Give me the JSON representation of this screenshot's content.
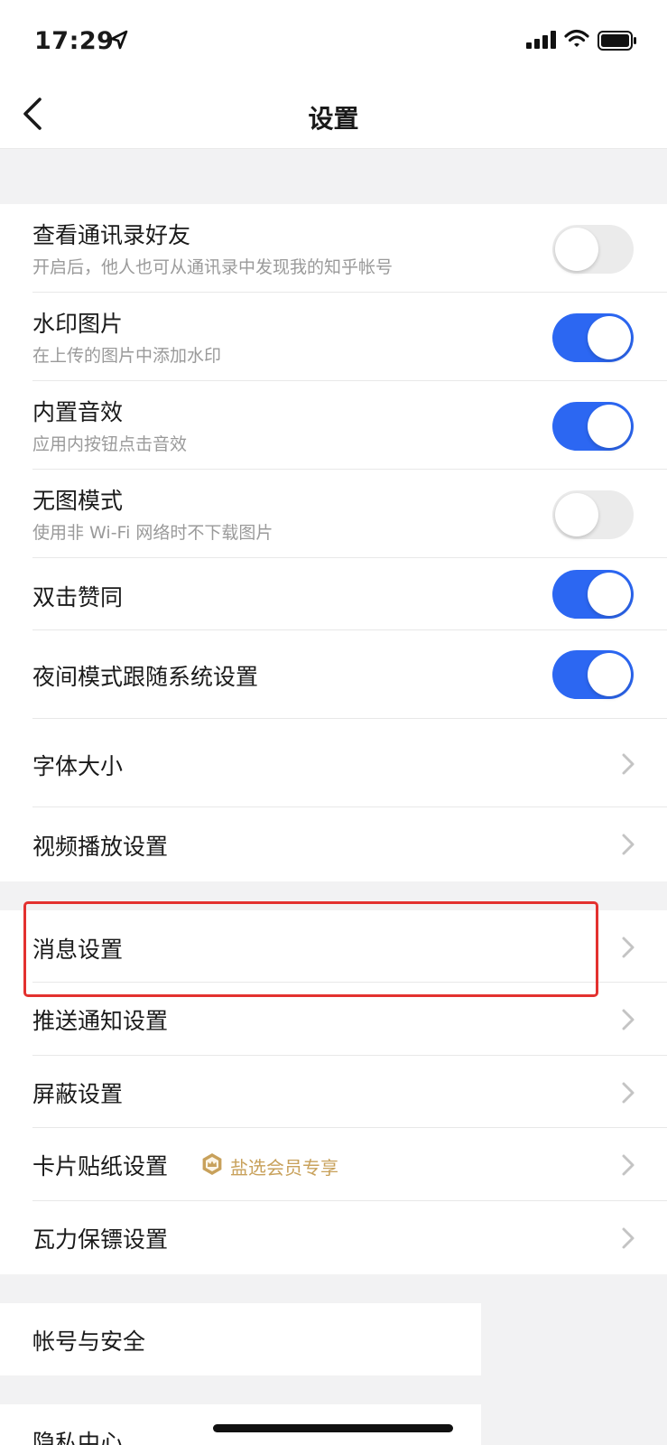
{
  "status_bar": {
    "time": "17:29"
  },
  "nav": {
    "title": "设置"
  },
  "group1": [
    {
      "title": "查看通讯录好友",
      "subtitle": "开启后，他人也可从通讯录中发现我的知乎帐号",
      "toggle": "off"
    },
    {
      "title": "水印图片",
      "subtitle": "在上传的图片中添加水印",
      "toggle": "on"
    },
    {
      "title": "内置音效",
      "subtitle": "应用内按钮点击音效",
      "toggle": "on"
    },
    {
      "title": "无图模式",
      "subtitle": "使用非 Wi-Fi 网络时不下载图片",
      "toggle": "off"
    },
    {
      "title": "双击赞同",
      "toggle": "on"
    },
    {
      "title": "夜间模式跟随系统设置",
      "toggle": "on"
    },
    {
      "title": "字体大小"
    },
    {
      "title": "视频播放设置"
    }
  ],
  "group2": [
    {
      "title": "消息设置"
    },
    {
      "title": "推送通知设置"
    },
    {
      "title": "屏蔽设置"
    },
    {
      "title": "卡片贴纸设置",
      "badge": "盐选会员专享"
    },
    {
      "title": "瓦力保镖设置"
    }
  ],
  "group3": [
    {
      "title": "帐号与安全"
    }
  ],
  "group4": [
    {
      "title": "隐私中心"
    }
  ],
  "colors": {
    "toggle_on": "#2c67f2",
    "toggle_off": "#ebebeb",
    "badge": "#c8a15b",
    "highlight": "#e3312f"
  }
}
